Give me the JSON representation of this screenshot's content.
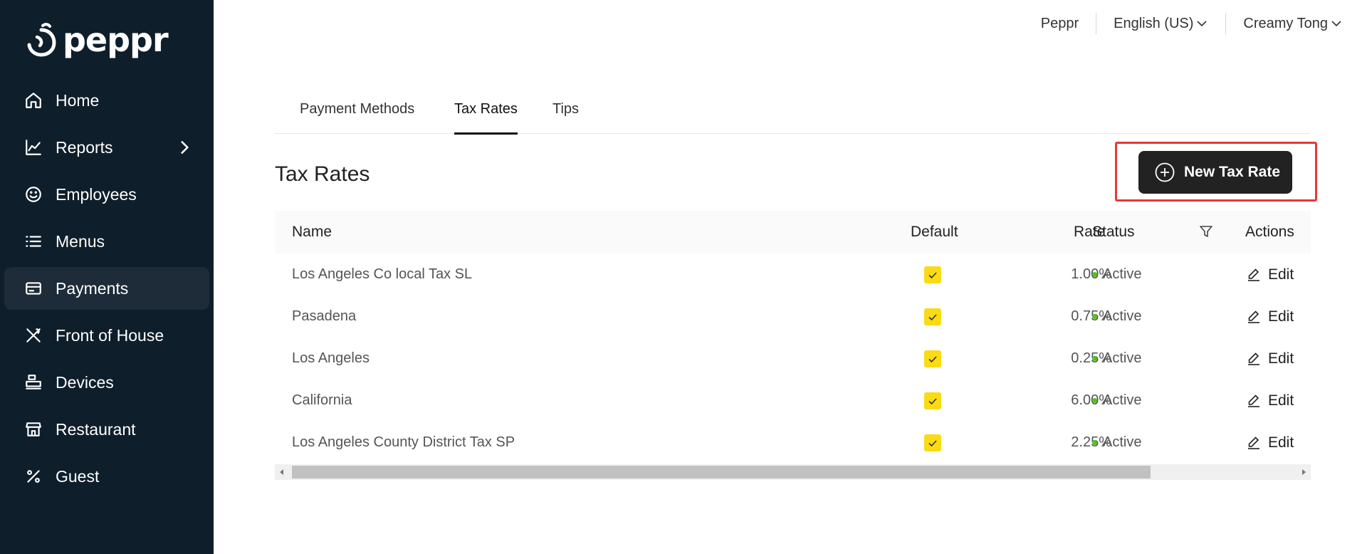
{
  "brand": {
    "name": "peppr"
  },
  "sidebar": {
    "items": [
      {
        "label": "Home",
        "icon": "home-icon"
      },
      {
        "label": "Reports",
        "icon": "chart-line-icon",
        "has_children": true
      },
      {
        "label": "Employees",
        "icon": "smiley-icon"
      },
      {
        "label": "Menus",
        "icon": "list-icon"
      },
      {
        "label": "Payments",
        "icon": "credit-card-icon",
        "active": true
      },
      {
        "label": "Front of House",
        "icon": "utensils-icon"
      },
      {
        "label": "Devices",
        "icon": "printer-icon"
      },
      {
        "label": "Restaurant",
        "icon": "storefront-icon"
      },
      {
        "label": "Guest",
        "icon": "percent-icon"
      }
    ]
  },
  "topbar": {
    "org": "Peppr",
    "language": "English (US)",
    "user": "Creamy Tong"
  },
  "tabs": [
    {
      "label": "Payment Methods"
    },
    {
      "label": "Tax Rates",
      "active": true
    },
    {
      "label": "Tips"
    }
  ],
  "page": {
    "title": "Tax Rates",
    "new_button": "New Tax Rate"
  },
  "table": {
    "columns": {
      "name": "Name",
      "rate": "Rate",
      "default": "Default",
      "status": "Status",
      "actions": "Actions"
    },
    "edit_label": "Edit",
    "rows": [
      {
        "name": "Los Angeles Co local Tax SL",
        "rate": "1.00%",
        "default": true,
        "status": "Active"
      },
      {
        "name": "Pasadena",
        "rate": "0.75%",
        "default": true,
        "status": "Active"
      },
      {
        "name": "Los Angeles",
        "rate": "0.25%",
        "default": true,
        "status": "Active"
      },
      {
        "name": "California",
        "rate": "6.00%",
        "default": true,
        "status": "Active"
      },
      {
        "name": "Los Angeles County District Tax SP",
        "rate": "2.25%",
        "default": true,
        "status": "Active"
      }
    ]
  },
  "colors": {
    "sidebar_bg": "#0f1e2b",
    "active_item_bg": "#1e2c39",
    "checkbox": "#fadb14",
    "status_active": "#52c41a",
    "highlight": "#e53935"
  }
}
